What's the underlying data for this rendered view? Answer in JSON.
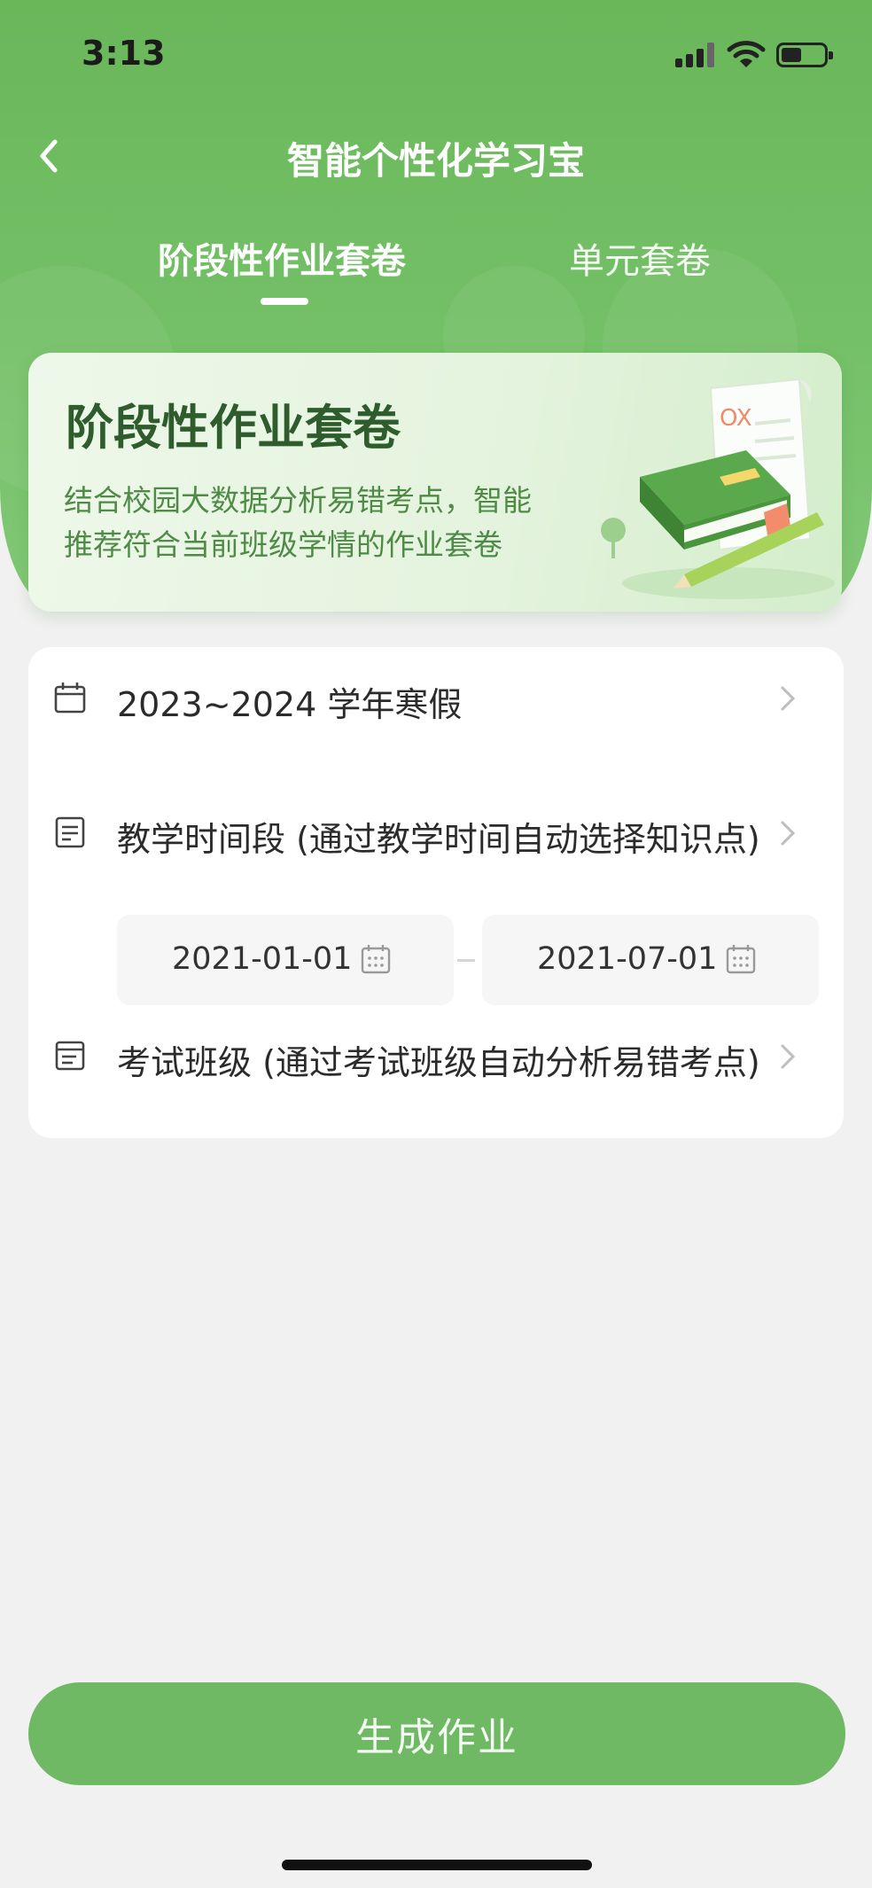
{
  "status_bar": {
    "time": "3:13"
  },
  "nav": {
    "title": "智能个性化学习宝",
    "back_icon": "chevron-left-icon"
  },
  "tabs": [
    {
      "label": "阶段性作业套卷",
      "active": true
    },
    {
      "label": "单元套卷",
      "active": false
    }
  ],
  "banner": {
    "title": "阶段性作业套卷",
    "line1": "结合校园大数据分析易错考点，智能",
    "line2": "推荐符合当前班级学情的作业套卷",
    "art_text": "OX"
  },
  "form": {
    "term": {
      "icon": "calendar-icon",
      "label": "2023~2024 学年寒假"
    },
    "teaching_period": {
      "icon": "document-icon",
      "label": "教学时间段 (通过教学时间自动选择知识点)",
      "start_date": "2021-01-01",
      "end_date": "2021-07-01"
    },
    "exam_class": {
      "icon": "class-list-icon",
      "label": "考试班级 (通过考试班级自动分析易错考点)"
    }
  },
  "actions": {
    "generate_label": "生成作业"
  },
  "colors": {
    "primary_green": "#6fb964",
    "header_green": "#6ab75a",
    "banner_title": "#2f5c2c"
  }
}
